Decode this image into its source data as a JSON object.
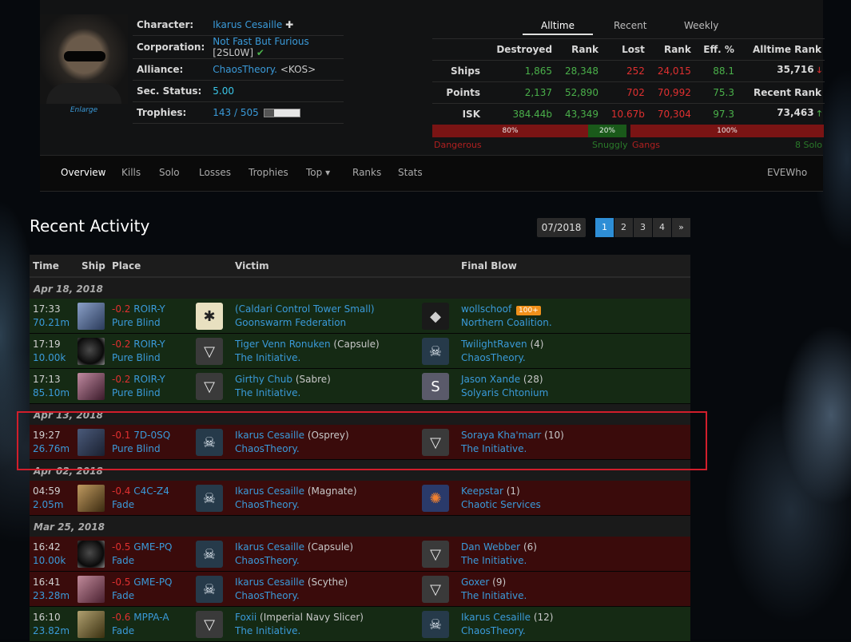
{
  "character": {
    "enlarge": "Enlarge",
    "fields": [
      {
        "label": "Character:",
        "value": "Ikarus Cesaille",
        "extra": "✚"
      },
      {
        "label": "Corporation:",
        "value": "Not Fast But Furious",
        "extra": "[2SL0W]",
        "check": "✔"
      },
      {
        "label": "Alliance:",
        "value": "ChaosTheory.",
        "extra": "<KOS>"
      },
      {
        "label": "Sec. Status:",
        "value": "5.00"
      },
      {
        "label": "Trophies:",
        "value": "143 / 505",
        "progress": 0.28
      }
    ]
  },
  "stats": {
    "tabs": [
      "Alltime",
      "Recent",
      "Weekly"
    ],
    "headers": [
      "Destroyed",
      "Rank",
      "Lost",
      "Rank",
      "Eff. %",
      "Alltime Rank"
    ],
    "rows": [
      {
        "label": "Ships",
        "destroyed": "1,865",
        "drank": "28,348",
        "lost": "252",
        "lrank": "24,015",
        "eff": "88.1",
        "rank_text": "35,716",
        "arrow": "🡓"
      },
      {
        "label": "Points",
        "destroyed": "2,137",
        "drank": "52,890",
        "lost": "702",
        "lrank": "70,992",
        "eff": "75.3",
        "rank_text": "Recent Rank",
        "arrow": ""
      },
      {
        "label": "ISK",
        "destroyed": "384.44b",
        "drank": "43,349",
        "lost": "10.67b",
        "lrank": "70,304",
        "eff": "97.3",
        "rank_text": "73,463",
        "arrow": "🡑"
      }
    ],
    "bars": {
      "dangerous_pct": "80%",
      "snuggly_pct": "20%",
      "gangs_pct": "100%",
      "dangerous": "Dangerous",
      "snuggly": "Snuggly",
      "gangs": "Gangs",
      "solo": "8 Solo",
      "dangerous_share": 0.8,
      "gangs_share": 1.0
    },
    "colors": {
      "red": "#7a1414",
      "green": "#1a5a1a",
      "grey": "#333333"
    }
  },
  "nav": {
    "items": [
      "Overview",
      "Kills",
      "Solo",
      "Losses",
      "Trophies",
      "Top",
      "Ranks",
      "Stats"
    ],
    "right": "EVEWho",
    "caret": "▾"
  },
  "activity": {
    "title": "Recent Activity",
    "month": "07/2018",
    "pages": [
      "1",
      "2",
      "3",
      "4",
      "»"
    ],
    "headers": [
      "Time",
      "Ship",
      "Place",
      "Victim",
      "Final Blow"
    ],
    "groups": [
      {
        "date": "Apr 18, 2018",
        "rows": [
          {
            "type": "win",
            "time": "17:33",
            "value": "70.21m",
            "sec": "-0.2",
            "system": "ROIR-Y",
            "region": "Pure Blind",
            "victim_name": "(Caldari Control Tower Small)",
            "victim_ship": "",
            "victim_corp": "Goonswarm Federation",
            "fb_name": "wollschoof",
            "fb_extra": "",
            "fb_badge": "100+",
            "fb_corp": "Northern Coalition.",
            "ship_icon": "tower-icon",
            "victim_logo": "bee",
            "fb_logo": "nc"
          },
          {
            "type": "win",
            "time": "17:19",
            "value": "10.00k",
            "sec": "-0.2",
            "system": "ROIR-Y",
            "region": "Pure Blind",
            "victim_name": "Tiger Venn Ronuken",
            "victim_ship": "(Capsule)",
            "victim_corp": "The Initiative.",
            "fb_name": "TwilightRaven",
            "fb_extra": "(4)",
            "fb_badge": "",
            "fb_corp": "ChaosTheory.",
            "ship_icon": "capsule-icon",
            "victim_logo": "init",
            "fb_logo": "skull"
          },
          {
            "type": "win",
            "time": "17:13",
            "value": "85.10m",
            "sec": "-0.2",
            "system": "ROIR-Y",
            "region": "Pure Blind",
            "victim_name": "Girthy Chub",
            "victim_ship": "(Sabre)",
            "victim_corp": "The Initiative.",
            "fb_name": "Jason Xande",
            "fb_extra": "(28)",
            "fb_badge": "",
            "fb_corp": "Solyaris Chtonium",
            "ship_icon": "sabre-icon",
            "victim_logo": "init",
            "fb_logo": "sc"
          }
        ]
      },
      {
        "date": "Apr 13, 2018",
        "rows": [
          {
            "type": "loss",
            "time": "19:27",
            "value": "26.76m",
            "sec": "-0.1",
            "system": "7D-0SQ",
            "region": "Pure Blind",
            "victim_name": "Ikarus Cesaille",
            "victim_ship": "(Osprey)",
            "victim_corp": "ChaosTheory.",
            "fb_name": "Soraya Kha'marr",
            "fb_extra": "(10)",
            "fb_badge": "",
            "fb_corp": "The Initiative.",
            "ship_icon": "osprey-icon",
            "victim_logo": "skull",
            "fb_logo": "init"
          }
        ]
      },
      {
        "date": "Apr 02, 2018",
        "rows": [
          {
            "type": "loss",
            "time": "04:59",
            "value": "2.05m",
            "sec": "-0.4",
            "system": "C4C-Z4",
            "region": "Fade",
            "victim_name": "Ikarus Cesaille",
            "victim_ship": "(Magnate)",
            "victim_corp": "ChaosTheory.",
            "fb_name": "Keepstar",
            "fb_extra": "(1)",
            "fb_badge": "",
            "fb_corp": "Chaotic Services",
            "ship_icon": "magnate-icon",
            "victim_logo": "skull",
            "fb_logo": "cs"
          }
        ]
      },
      {
        "date": "Mar 25, 2018",
        "rows": [
          {
            "type": "loss",
            "time": "16:42",
            "value": "10.00k",
            "sec": "-0.5",
            "system": "GME-PQ",
            "region": "Fade",
            "victim_name": "Ikarus Cesaille",
            "victim_ship": "(Capsule)",
            "victim_corp": "ChaosTheory.",
            "fb_name": "Dan Webber",
            "fb_extra": "(6)",
            "fb_badge": "",
            "fb_corp": "The Initiative.",
            "ship_icon": "capsule-icon",
            "victim_logo": "skull",
            "fb_logo": "init"
          },
          {
            "type": "loss",
            "time": "16:41",
            "value": "23.28m",
            "sec": "-0.5",
            "system": "GME-PQ",
            "region": "Fade",
            "victim_name": "Ikarus Cesaille",
            "victim_ship": "(Scythe)",
            "victim_corp": "ChaosTheory.",
            "fb_name": "Goxer",
            "fb_extra": "(9)",
            "fb_badge": "",
            "fb_corp": "The Initiative.",
            "ship_icon": "scythe-icon",
            "victim_logo": "skull",
            "fb_logo": "init"
          },
          {
            "type": "win",
            "time": "16:10",
            "value": "23.82m",
            "sec": "-0.6",
            "system": "MPPA-A",
            "region": "Fade",
            "victim_name": "Foxii",
            "victim_ship": "(Imperial Navy Slicer)",
            "victim_corp": "The Initiative.",
            "fb_name": "Ikarus Cesaille",
            "fb_extra": "(12)",
            "fb_badge": "",
            "fb_corp": "ChaosTheory.",
            "ship_icon": "slicer-icon",
            "victim_logo": "init",
            "fb_logo": "skull"
          }
        ]
      }
    ]
  }
}
